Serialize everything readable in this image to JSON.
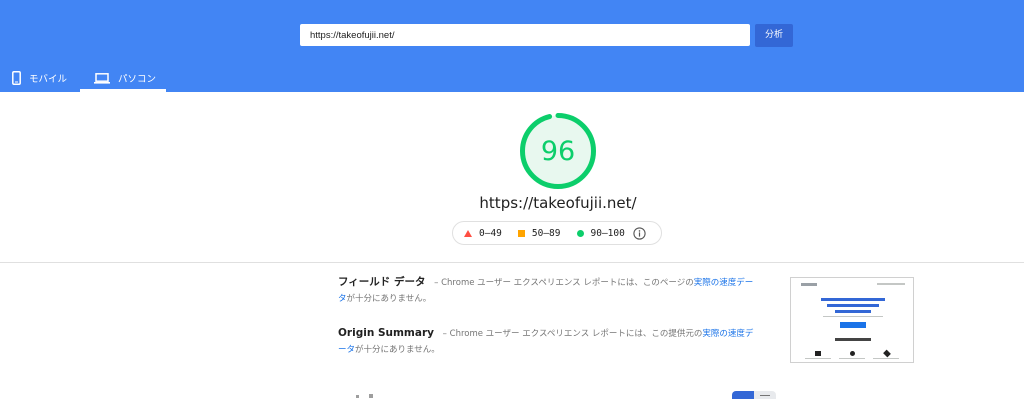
{
  "search": {
    "url_value": "https://takeofujii.net/",
    "analyze_label": "分析"
  },
  "tabs": [
    {
      "label": "モバイル",
      "icon": "smartphone-icon",
      "active": false
    },
    {
      "label": "パソコン",
      "icon": "laptop-icon",
      "active": true
    }
  ],
  "score": {
    "value": "96",
    "fraction": 0.96,
    "color": "#0cce6b"
  },
  "page_url": "https://takeofujii.net/",
  "legend": {
    "items": [
      {
        "range": "0–49",
        "symbol": "triangle",
        "color": "#ff4e42"
      },
      {
        "range": "50–89",
        "symbol": "square",
        "color": "#ffa400"
      },
      {
        "range": "90–100",
        "symbol": "circle",
        "color": "#0cce6b"
      }
    ],
    "info_icon": "info-icon"
  },
  "field_data": {
    "title": "フィールド データ",
    "text": " – Chrome ユーザー エクスペリエンス レポートには、このページの",
    "link": "実際の速度データ",
    "suffix": "が十分にありません。"
  },
  "origin_summary": {
    "title": "Origin Summary",
    "text": " – Chrome ユーザー エクスペリエンス レポートには、この提供元の",
    "link": "実際の速度データ",
    "suffix": "が十分にありません。"
  },
  "screenshot": {
    "icon": "page-screenshot-thumbnail"
  },
  "colors": {
    "header": "#4285f4",
    "button": "#3367d6",
    "link": "#1a73e8",
    "pass": "#0cce6b",
    "average": "#ffa400",
    "fail": "#ff4e42"
  }
}
